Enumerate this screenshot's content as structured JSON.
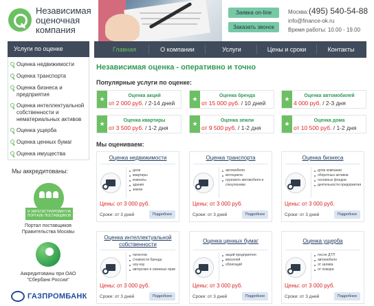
{
  "header": {
    "logo_lines": [
      "Независимая",
      "оценочная",
      "компания"
    ],
    "btn_order": "Заявка on-line",
    "btn_call": "Заказать звонок",
    "city": "Москва:",
    "phone": "(495) 540-54-88",
    "email": "info@finance-ok.ru",
    "hours": "Время работы: 10.00 - 19.00"
  },
  "nav": [
    "Главная",
    "О компании",
    "Услуги",
    "Цены и сроки",
    "Контакты"
  ],
  "sidebar": {
    "title": "Услуги по оценке",
    "items": [
      "Оценка недвижимости",
      "Оценка транспорта",
      "Оценка бизнеса и предприятия",
      "Оценка интеллектуальной собственности и нематериальных активов",
      "Оценка ущерба",
      "Оценка ценных бумаг",
      "Оценка имущества"
    ]
  },
  "accredited": {
    "title": "Мы аккредитованы:",
    "badge": "Я ЗАРЕГИСТРИРОВАН НА ПОРТАЛЕ ПОСТАВЩИКОВ",
    "caption1": "Портал поставщиков Правительства Москвы",
    "caption2": "Аккредитованы при ОАО \"Сбербанк России\"",
    "gpb": "ГАЗПРОМБАНК"
  },
  "main": {
    "heading": "Независимая оценка - оперативно и точно",
    "popular_heading": "Популярные услуги по оценке:",
    "popular": [
      {
        "title": "Оценка акций",
        "price": "от 2 000 руб.",
        "term": " / 2-14 дней"
      },
      {
        "title": "Оценка бренда",
        "price": "от 15 000 руб.",
        "term": " / 10 дней"
      },
      {
        "title": "Оценка автомобилей",
        "price": "4 000 руб.",
        "term": " / 2-3 дня"
      },
      {
        "title": "Оценка квартиры",
        "price": "от 3 500 руб.",
        "term": " / 1-2 дня"
      },
      {
        "title": "Оценка земли",
        "price": "от 9 500 руб.",
        "term": " / 1-2 дня"
      },
      {
        "title": "Оценка дома",
        "price": "от 10 500 руб.",
        "term": " / 1-2 дня"
      }
    ],
    "we_evaluate": "Мы оцениваем:",
    "cards": [
      {
        "title": "Оценка недвижимости",
        "items": [
          "доли",
          "квартиры",
          "комнаты",
          "здания",
          "земли"
        ],
        "price": "Цены: от 3 000 руб.",
        "term": "Сроки: от 3 дней",
        "more": "Подробнее"
      },
      {
        "title": "Оценка транспорта",
        "items": [
          "автомобили",
          "мотоцикла",
          "грузового автомобиля и спецтехники"
        ],
        "price": "Цены: от 3 000 руб.",
        "term": "Сроки: от 3 дней",
        "more": "Подробнее"
      },
      {
        "title": "Оценка бизнеса",
        "items": [
          "доли компании",
          "оборотных активов",
          "основных фондов",
          "деятельности предприятия"
        ],
        "price": "Цены: от 3 000 руб.",
        "term": "Сроки: от 3 дней",
        "more": "Подробнее"
      },
      {
        "title": "Оценка интеллектуальной собственности",
        "items": [
          "патентов",
          "стоимости бренда",
          "ноу-хау",
          "авторских и смежных прав"
        ],
        "price": "Цены: от 3 000 руб.",
        "term": "Сроки: от 3 дней",
        "more": "Подробнее"
      },
      {
        "title": "Оценка ценных бумаг",
        "items": [
          "акций предприятия",
          "векселей",
          "облигаций"
        ],
        "price": "Цены: от 3 000 руб.",
        "term": "Сроки: от 3 дней",
        "more": "Подробнее"
      },
      {
        "title": "Оценка ущерба",
        "items": [
          "после ДТП",
          "автомобиля",
          "от залива",
          "от пожара"
        ],
        "price": "Цены: от 3 000 руб.",
        "term": "Сроки: от 3 дней",
        "more": "Подробнее"
      }
    ]
  }
}
